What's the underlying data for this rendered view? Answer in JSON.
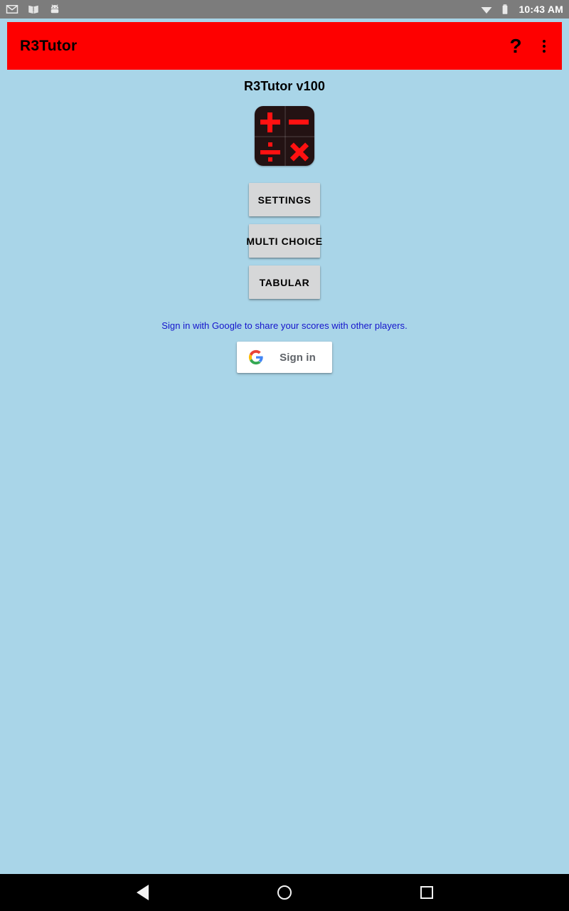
{
  "status_bar": {
    "icons": [
      "gmail-icon",
      "book-icon",
      "android-robot-icon"
    ],
    "wifi_icon": "wifi-icon",
    "battery_icon": "battery-icon",
    "time": "10:43 AM",
    "background_color": "#7c7c7c"
  },
  "app_bar": {
    "title": "R3Tutor",
    "background_color": "#fe0000",
    "help_icon": "?",
    "overflow_icon": "overflow-menu-icon"
  },
  "main": {
    "version_title": "R3Tutor v100",
    "app_icon": {
      "name": "calculator-symbols-icon",
      "symbols": [
        "plus",
        "minus",
        "divide",
        "multiply"
      ],
      "background_color": "#231213",
      "symbol_color": "#ff1111"
    },
    "buttons": [
      {
        "label": "SETTINGS",
        "name": "settings-button"
      },
      {
        "label": "MULTI CHOICE",
        "name": "multi-choice-button"
      },
      {
        "label": "TABULAR",
        "name": "tabular-button"
      }
    ],
    "signin": {
      "hint": "Sign in with Google to share your scores with other players.",
      "hint_color": "#1414cc",
      "button_label": "Sign in",
      "logo_icon": "google-g-icon"
    },
    "background_color": "#a9d5e8"
  },
  "nav_bar": {
    "back_label": "Back",
    "home_label": "Home",
    "recents_label": "Recents",
    "background_color": "#000000"
  }
}
